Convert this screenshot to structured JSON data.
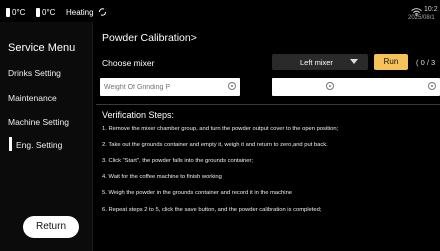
{
  "status": {
    "temp1": "0°C",
    "temp2": "0°C",
    "heating": "Heating",
    "time": "10:2",
    "date": "2025/08/1"
  },
  "sidebar": {
    "title": "Service Menu",
    "items": [
      {
        "label": "Drinks Setting"
      },
      {
        "label": "Maintenance"
      },
      {
        "label": "Machine Setting"
      },
      {
        "label": "Eng. Setting",
        "active": true
      }
    ],
    "return_label": "Return"
  },
  "main": {
    "title": "Powder Calibration>",
    "mixer_label": "Choose mixer",
    "mixer_value": "Left mixer",
    "run_label": "Run",
    "run_count": "( 0 / 3",
    "weight_label": "Weight Of Grinding P",
    "verification_title": "Verification Steps:",
    "steps": [
      "1. Remove the mixer chamber group, and turn the powder output cover to the open position;",
      "2. Take out the grounds container and empty it, weigh it and return to zero,and put back.",
      "3. Click \"Start\", the powder falls into the grounds container;",
      "4. Wait for the coffee machine to finish working",
      "5. Weigh the powder in the grounds container and record it in the machine",
      "6. Repeat steps 2 to 5, click the save button, and the powder calibration is completed;"
    ]
  },
  "colors": {
    "background": "#000000",
    "run_button": "#f6c35a",
    "select": "#2a2a2a"
  }
}
